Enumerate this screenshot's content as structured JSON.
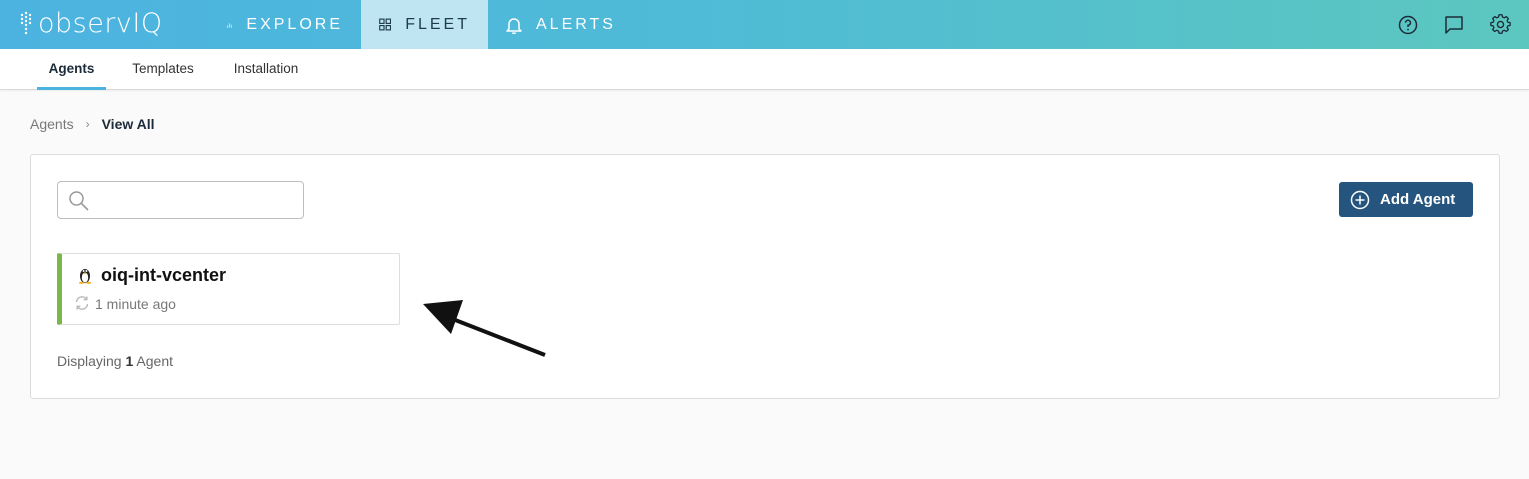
{
  "app": {
    "logo_text": "observIQ"
  },
  "nav": {
    "items": [
      {
        "label": "EXPLORE",
        "icon": "bar-chart-icon",
        "active": false
      },
      {
        "label": "FLEET",
        "icon": "grid-icon",
        "active": true
      },
      {
        "label": "ALERTS",
        "icon": "bell-icon",
        "active": false
      }
    ],
    "right_icons": [
      "help-icon",
      "chat-icon",
      "gear-icon"
    ]
  },
  "subtabs": [
    {
      "label": "Agents",
      "active": true
    },
    {
      "label": "Templates",
      "active": false
    },
    {
      "label": "Installation",
      "active": false
    }
  ],
  "breadcrumb": {
    "parent": "Agents",
    "current": "View All"
  },
  "search": {
    "value": "",
    "placeholder": ""
  },
  "add_button": {
    "label": "Add Agent"
  },
  "agents": [
    {
      "name": "oiq-int-vcenter",
      "os_icon": "linux-penguin-icon",
      "last_seen": "1 minute ago",
      "status_color": "#7ab648"
    }
  ],
  "footer": {
    "prefix": "Displaying",
    "count": "1",
    "suffix": "Agent"
  },
  "colors": {
    "topbar_start": "#4cb3e0",
    "topbar_end": "#5cc7bf",
    "active_nav_bg": "#bfe5f3",
    "primary_button": "#25547e",
    "agent_status": "#7ab648"
  }
}
